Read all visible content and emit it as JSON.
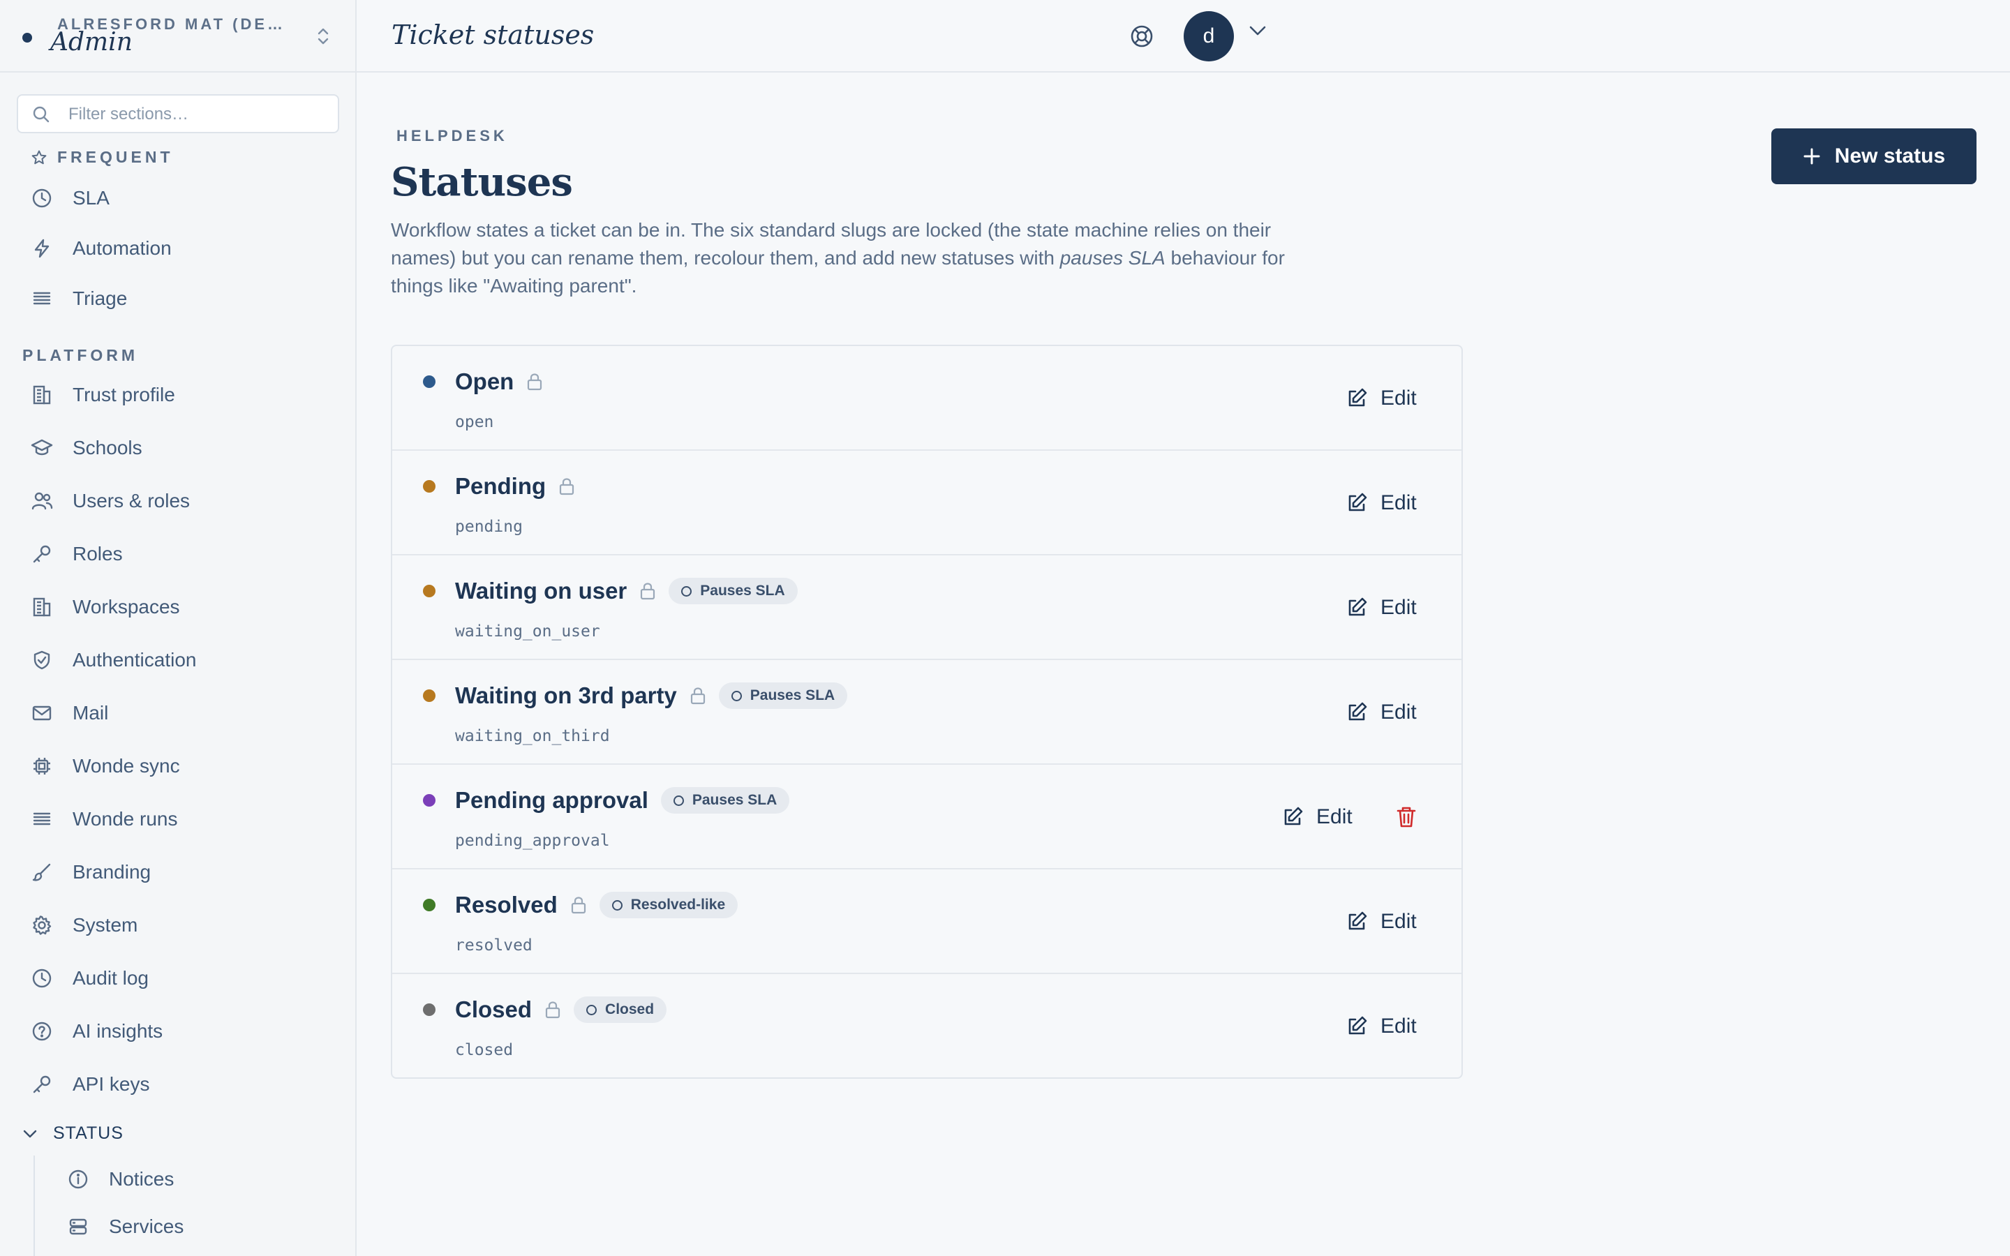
{
  "sidebar": {
    "org_name": "ALRESFORD MAT (DE…",
    "org_role": "Admin",
    "filter_placeholder": "Filter sections…",
    "frequent_label": "FREQUENT",
    "frequent": [
      {
        "label": "SLA",
        "icon": "clock-icon"
      },
      {
        "label": "Automation",
        "icon": "bolt-icon"
      },
      {
        "label": "Triage",
        "icon": "list-icon"
      }
    ],
    "platform_label": "PLATFORM",
    "platform": [
      {
        "label": "Trust profile",
        "icon": "building-icon"
      },
      {
        "label": "Schools",
        "icon": "graduation-cap-icon"
      },
      {
        "label": "Users & roles",
        "icon": "users-icon"
      },
      {
        "label": "Roles",
        "icon": "key-icon"
      },
      {
        "label": "Workspaces",
        "icon": "building-icon"
      },
      {
        "label": "Authentication",
        "icon": "shield-check-icon"
      },
      {
        "label": "Mail",
        "icon": "mail-icon"
      },
      {
        "label": "Wonde sync",
        "icon": "chip-icon"
      },
      {
        "label": "Wonde runs",
        "icon": "list-icon"
      },
      {
        "label": "Branding",
        "icon": "brush-icon"
      },
      {
        "label": "System",
        "icon": "gear-icon"
      },
      {
        "label": "Audit log",
        "icon": "clock-icon"
      },
      {
        "label": "AI insights",
        "icon": "help-circle-icon"
      },
      {
        "label": "API keys",
        "icon": "key-icon"
      }
    ],
    "status_label": "STATUS",
    "status": [
      {
        "label": "Notices",
        "icon": "info-icon"
      },
      {
        "label": "Services",
        "icon": "database-icon"
      }
    ]
  },
  "topbar": {
    "title": "Ticket statuses",
    "avatar_initial": "d"
  },
  "main": {
    "eyebrow": "HELPDESK",
    "title": "Statuses",
    "desc_part1": "Workflow states a ticket can be in. The six standard slugs are locked (the state machine relies on their names) but you can rename them, recolour them, and add new statuses with ",
    "desc_em": "pauses SLA",
    "desc_part2": " behaviour for things like \"Awaiting parent\".",
    "new_button": "New status",
    "edit_label": "Edit",
    "statuses": [
      {
        "name": "Open",
        "slug": "open",
        "color": "#2d5a8c",
        "locked": true,
        "badge": ""
      },
      {
        "name": "Pending",
        "slug": "pending",
        "color": "#b7791f",
        "locked": true,
        "badge": ""
      },
      {
        "name": "Waiting on user",
        "slug": "waiting_on_user",
        "color": "#b7791f",
        "locked": true,
        "badge": "Pauses SLA"
      },
      {
        "name": "Waiting on 3rd party",
        "slug": "waiting_on_third",
        "color": "#b7791f",
        "locked": true,
        "badge": "Pauses SLA"
      },
      {
        "name": "Pending approval",
        "slug": "pending_approval",
        "color": "#7b3fb8",
        "locked": false,
        "badge": "Pauses SLA"
      },
      {
        "name": "Resolved",
        "slug": "resolved",
        "color": "#3f7a26",
        "locked": true,
        "badge": "Resolved-like"
      },
      {
        "name": "Closed",
        "slug": "closed",
        "color": "#6e6e6e",
        "locked": true,
        "badge": "Closed"
      }
    ]
  },
  "colors": {
    "accent": "#1e3553",
    "danger": "#d02a2a"
  }
}
